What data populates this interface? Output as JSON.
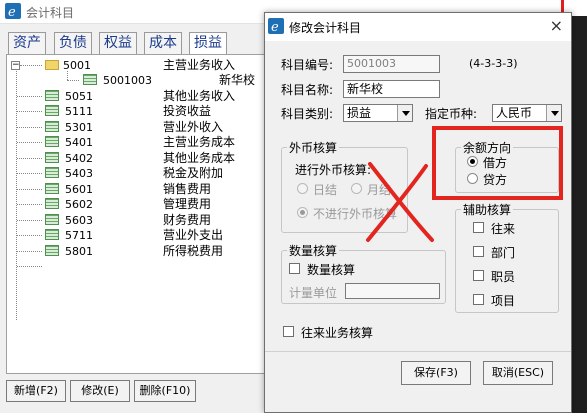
{
  "bgwindow": {
    "title": "会计科目",
    "tabs": [
      "资产",
      "负债",
      "权益",
      "成本",
      "损益"
    ],
    "tree": [
      {
        "code": "5001",
        "name": "主营业务收入"
      },
      {
        "code": "5001003",
        "name": "新华校"
      },
      {
        "code": "5051",
        "name": "其他业务收入"
      },
      {
        "code": "5111",
        "name": "投资收益"
      },
      {
        "code": "5301",
        "name": "营业外收入"
      },
      {
        "code": "5401",
        "name": "主营业务成本"
      },
      {
        "code": "5402",
        "name": "其他业务成本"
      },
      {
        "code": "5403",
        "name": "税金及附加"
      },
      {
        "code": "5601",
        "name": "销售费用"
      },
      {
        "code": "5602",
        "name": "管理费用"
      },
      {
        "code": "5603",
        "name": "财务费用"
      },
      {
        "code": "5711",
        "name": "营业外支出"
      },
      {
        "code": "5801",
        "name": "所得税费用"
      }
    ],
    "buttons": {
      "add": "新增(F2)",
      "edit": "修改(E)",
      "delete": "删除(F10)"
    },
    "expander": "−"
  },
  "dialog": {
    "title": "修改会计科目",
    "close": "×",
    "code_label": "科目编号:",
    "code_value": "5001003",
    "code_format": "(4-3-3-3)",
    "name_label": "科目名称:",
    "name_value": "新华校",
    "type_label": "科目类别:",
    "type_value": "损益",
    "currency_label": "指定币种:",
    "currency_value": "人民币",
    "fx_group": {
      "title": "外币核算",
      "question": "进行外币核算:",
      "option_daily": "日结",
      "option_monthly": "月结",
      "option_none": "不进行外币核算"
    },
    "balance_group": {
      "title": "余额方向",
      "debit": "借方",
      "credit": "贷方"
    },
    "aux_group": {
      "title": "辅助核算",
      "items": [
        "往来",
        "部门",
        "职员",
        "项目"
      ]
    },
    "qty_group": {
      "title": "数量核算",
      "checkbox": "数量核算",
      "unit_label": "计量单位"
    },
    "transactions_checkbox": "往来业务核算",
    "save": "保存(F3)",
    "cancel": "取消(ESC)"
  },
  "colors": {
    "annotation_red": "#e3251f",
    "tab_text": "#1b3a8c"
  },
  "icons": [
    "app-logo-icon",
    "folder-icon",
    "ledger-icon",
    "close-icon",
    "chevron-down-icon"
  ]
}
